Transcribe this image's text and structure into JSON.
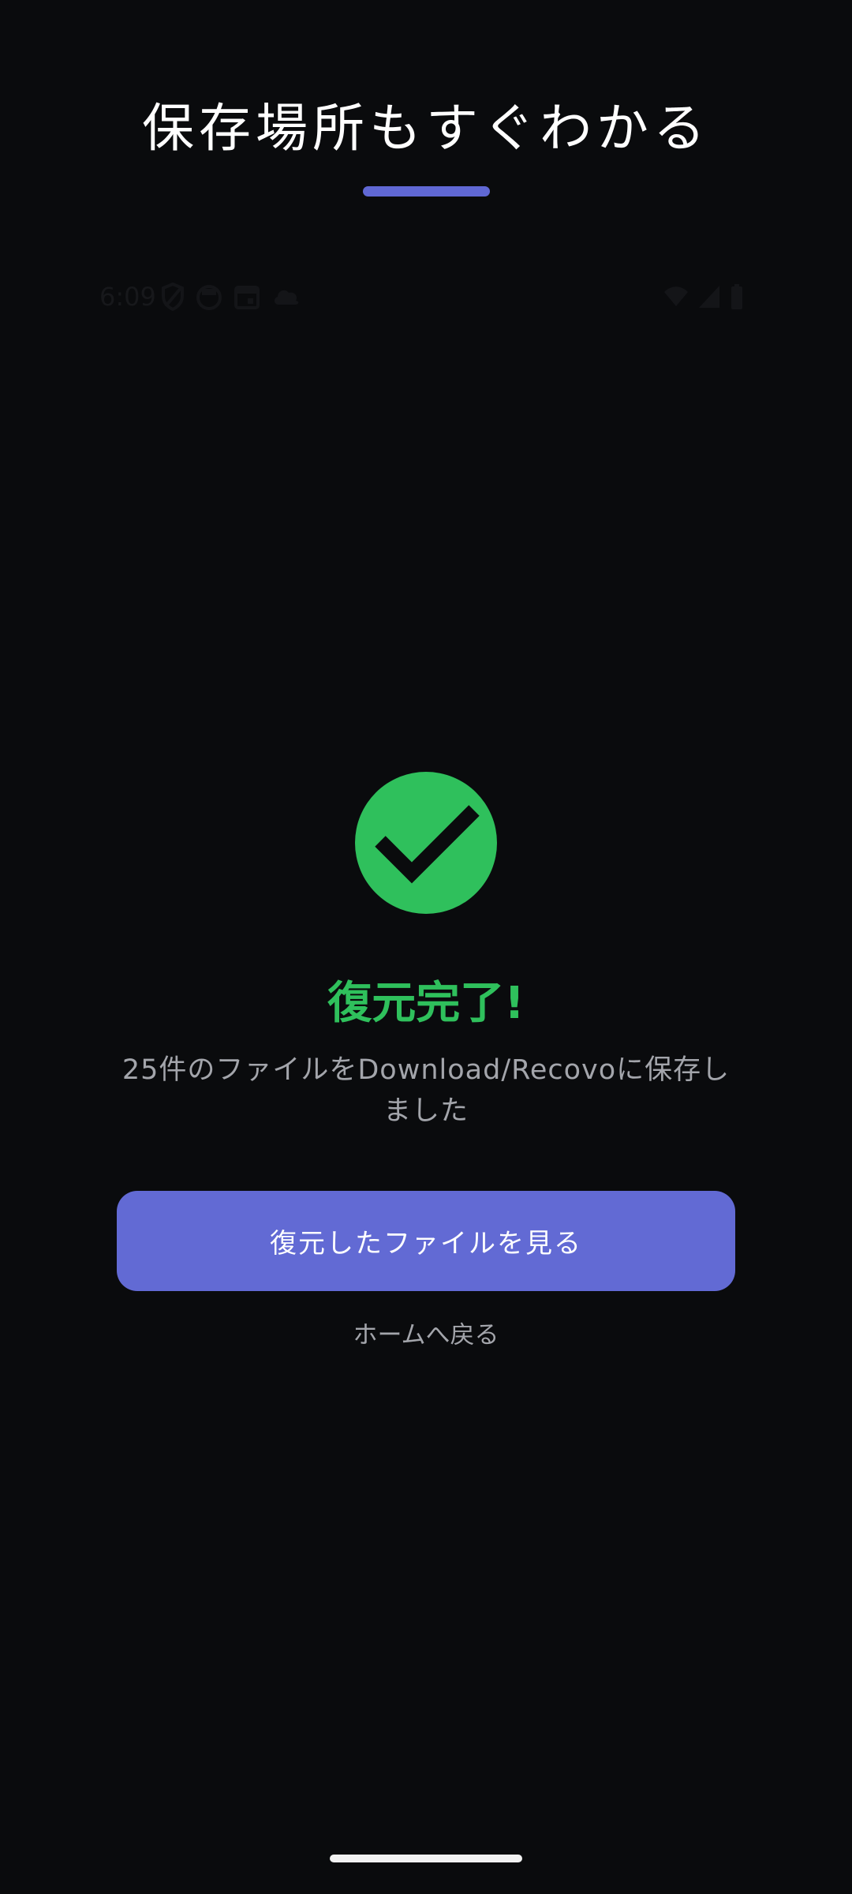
{
  "promo": {
    "title": "保存場所もすぐわかる"
  },
  "status_bar": {
    "time": "6:09",
    "left_icons": [
      "shield-icon",
      "mask-icon",
      "calendar-icon",
      "cloud-icon"
    ],
    "right_icons": [
      "wifi-icon",
      "cell-signal-icon",
      "battery-icon"
    ]
  },
  "result": {
    "icon": "check-circle-icon",
    "title": "復元完了!",
    "message": "25件のファイルをDownload/Recovoに保存しました"
  },
  "actions": {
    "primary_label": "復元したファイルを見る",
    "secondary_label": "ホームへ戻る"
  },
  "colors": {
    "background": "#0a0b0d",
    "accent": "#626ad4",
    "success": "#2fc05c",
    "muted_text": "#a3a5ab"
  }
}
